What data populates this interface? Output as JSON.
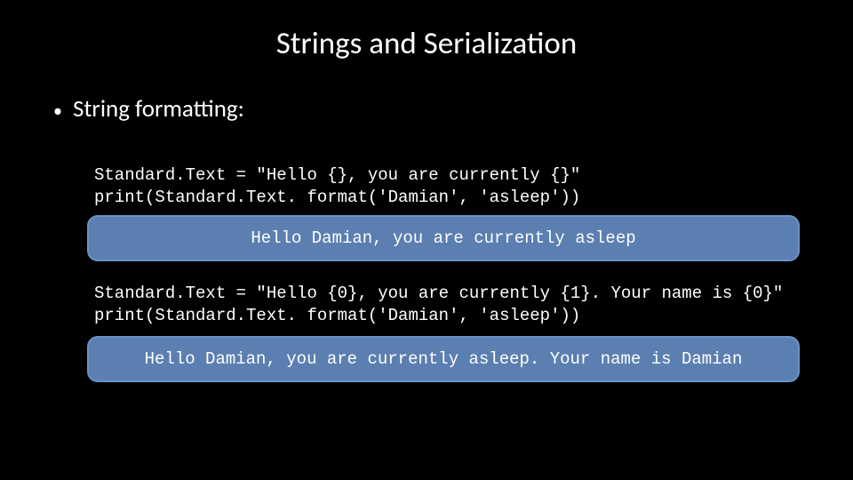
{
  "title": "Strings and Serialization",
  "bullet": "String formatting:",
  "example1": {
    "code": "Standard.Text = \"Hello {}, you are currently {}\"\nprint(Standard.Text. format('Damian', 'asleep'))",
    "output": "Hello Damian, you are currently asleep"
  },
  "example2": {
    "code": "Standard.Text = \"Hello {0}, you are currently {1}. Your name is {0}\"\nprint(Standard.Text. format('Damian', 'asleep'))",
    "output": "Hello Damian, you are currently asleep. Your name is Damian"
  }
}
